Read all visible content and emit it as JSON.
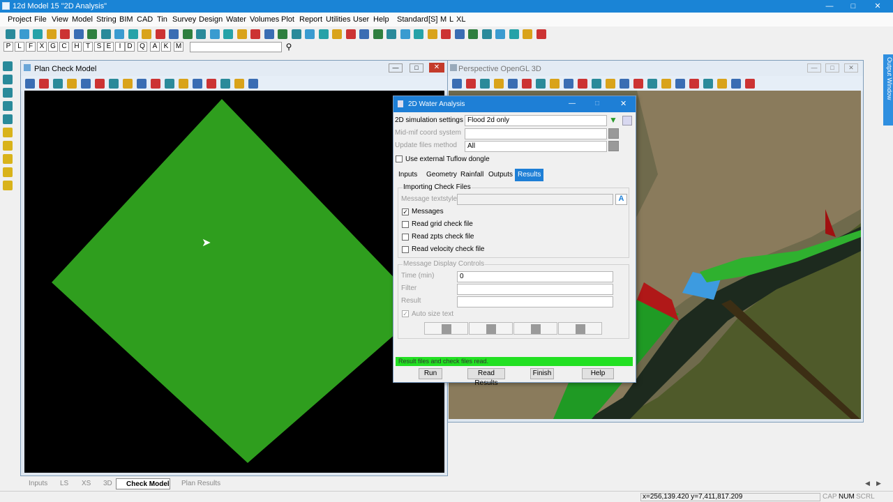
{
  "app": {
    "title": "12d Model 15 \"2D Analysis\""
  },
  "menu": [
    "Project",
    "File",
    "View",
    "Model",
    "String",
    "BIM",
    "CAD",
    "Tin",
    "Survey",
    "Design",
    "Water",
    "Volumes",
    "Plot",
    "Report",
    "Utilities",
    "User",
    "Help",
    "Standard",
    "[S]",
    "M",
    "L",
    "XL"
  ],
  "letters": [
    "P",
    "L",
    "F",
    "X",
    "G",
    "C",
    "H",
    "T",
    "S",
    "E",
    "I",
    "D",
    "Q",
    "A",
    "K",
    "M"
  ],
  "plan_window": {
    "title": "Plan Check Model"
  },
  "persp_window": {
    "title": "Perspective OpenGL 3D"
  },
  "output_window": {
    "label": "Output Window"
  },
  "dialog": {
    "title": "2D Water Analysis",
    "sim_label": "2D simulation settings",
    "sim_value": "Flood 2d only",
    "coord_label": "Mid-mif coord system",
    "coord_value": "",
    "update_label": "Update files method",
    "update_value": "All",
    "tuflow_label": "Use external Tuflow dongle",
    "tuflow_checked": false,
    "tabs": [
      "Inputs",
      "Geometry",
      "Rainfall",
      "Outputs",
      "Results"
    ],
    "active_tab": "Results",
    "import_group": "Importing Check Files",
    "textstyle_label": "Message textstyle",
    "textstyle_value": "",
    "messages_label": "Messages",
    "messages_checked": true,
    "grid_label": "Read grid check file",
    "zpts_label": "Read zpts check file",
    "velocity_label": "Read velocity check file",
    "display_group": "Message Display Controls",
    "time_label": "Time (min)",
    "time_value": "0",
    "filter_label": "Filter",
    "filter_value": "",
    "result_label": "Result",
    "result_value": "",
    "autosize_label": "Auto size text",
    "status_msg": "Result files and check files read.",
    "buttons": [
      "Run",
      "Read Results",
      "Finish",
      "Help"
    ]
  },
  "bottom_tabs": [
    "Inputs",
    "LS",
    "XS",
    "3D",
    "Check Model",
    "Plan Results"
  ],
  "active_bottom_tab": "Check Model",
  "status": {
    "coords": "x=256,139.420 y=7,411,817.209",
    "caps": [
      "CAP",
      "NUM",
      "SCRL"
    ]
  },
  "colors": {
    "titlebar": "#1a84d6",
    "green_status": "#22e022",
    "model_green": "#2f9e1e",
    "tab_active": "#1e7fd6"
  }
}
